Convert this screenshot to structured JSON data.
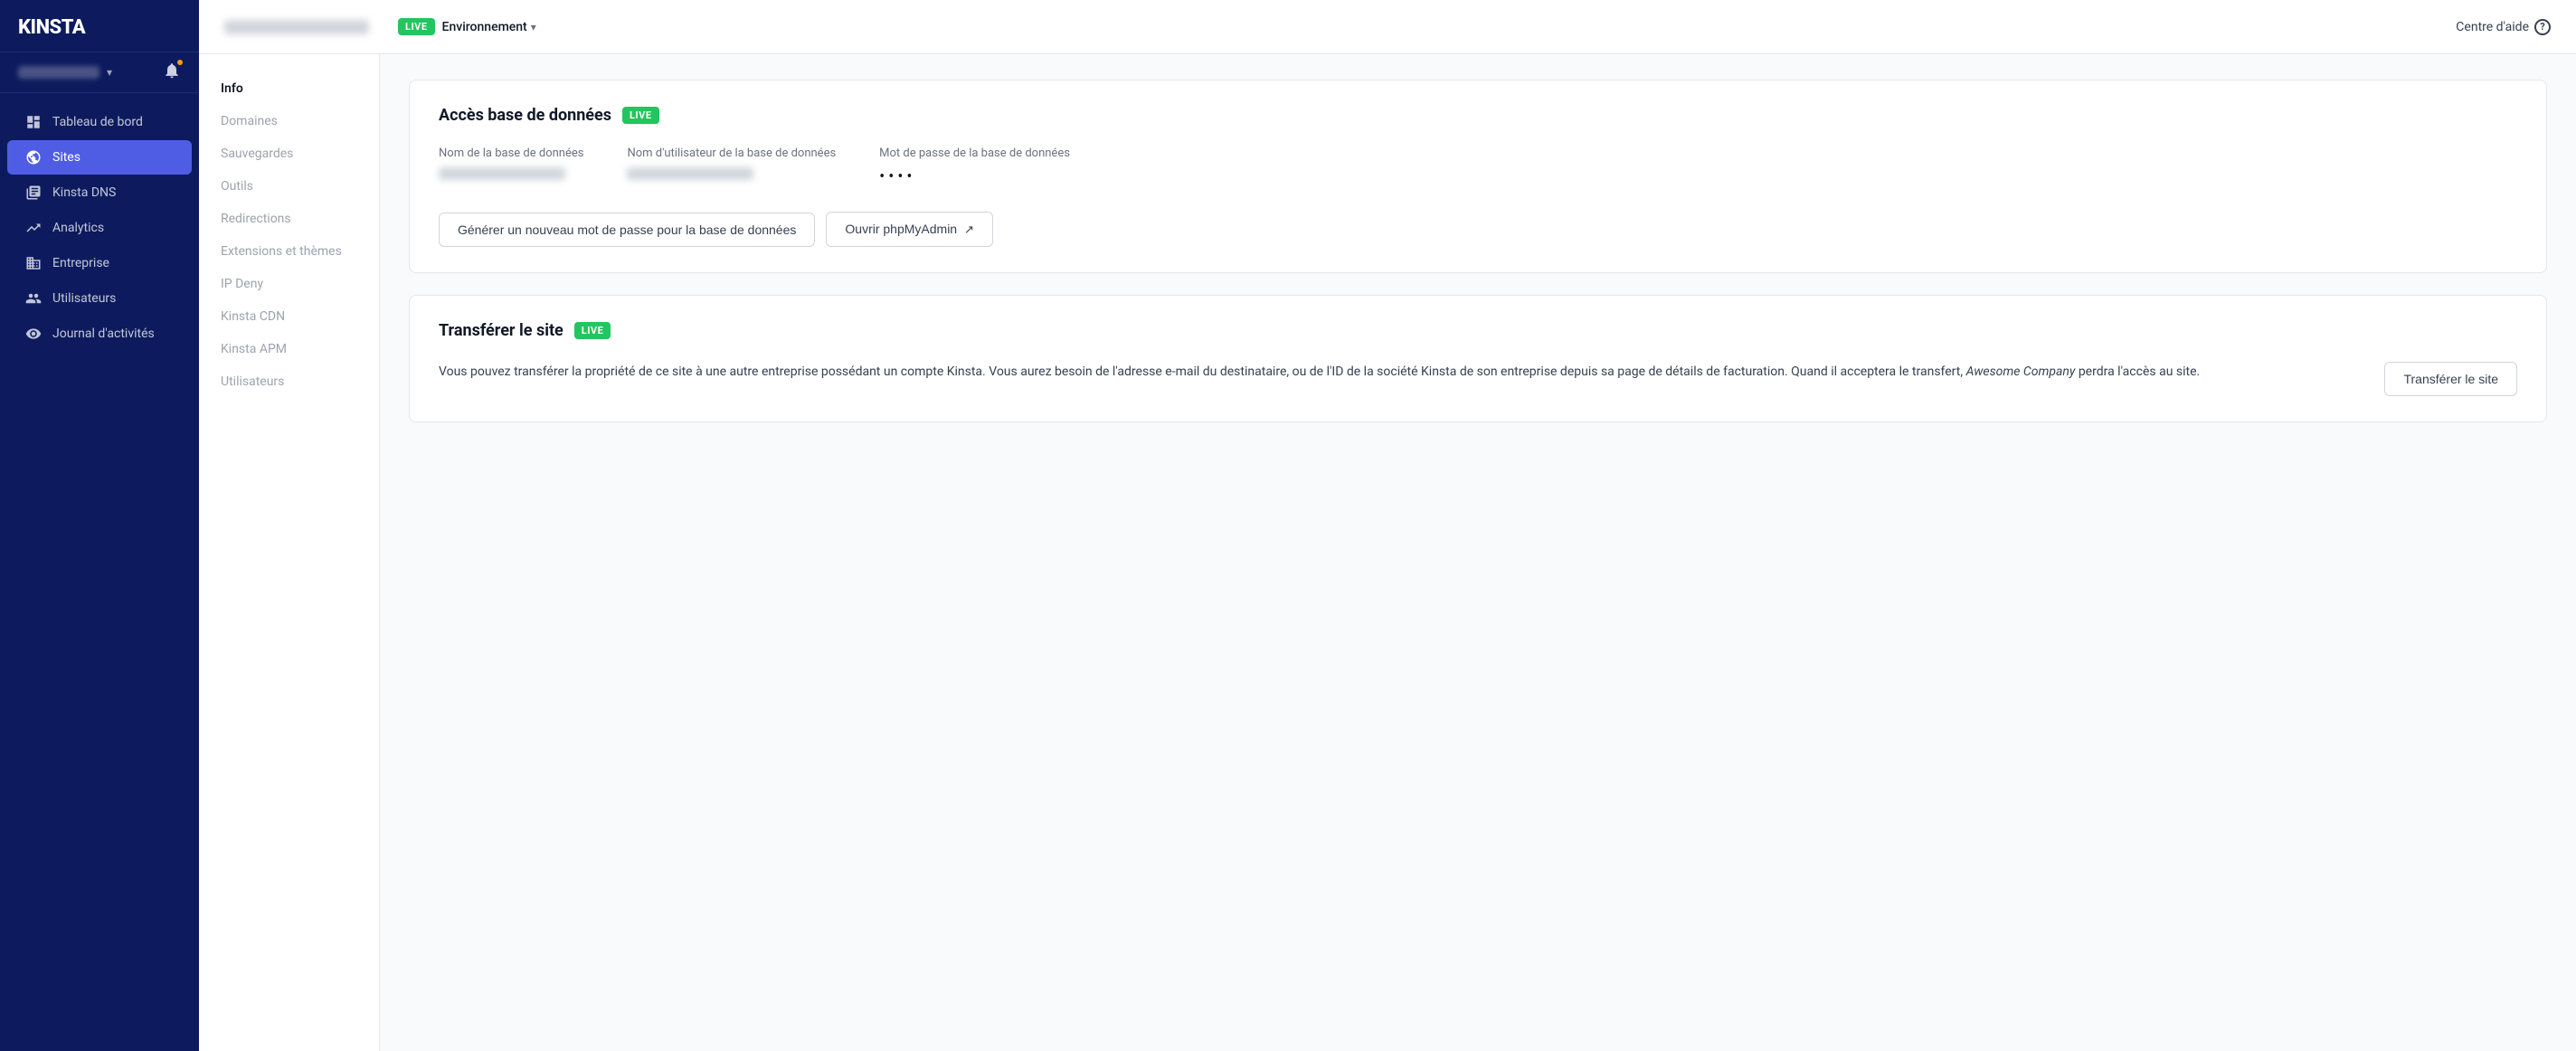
{
  "sidebar": {
    "logo": "KINSTA",
    "account_name_placeholder": "account",
    "nav_items": [
      {
        "id": "tableau-de-bord",
        "label": "Tableau de bord",
        "icon": "home",
        "active": false
      },
      {
        "id": "sites",
        "label": "Sites",
        "icon": "globe",
        "active": true
      },
      {
        "id": "kinsta-dns",
        "label": "Kinsta DNS",
        "icon": "dns",
        "active": false
      },
      {
        "id": "analytics",
        "label": "Analytics",
        "icon": "chart",
        "active": false
      },
      {
        "id": "entreprise",
        "label": "Entreprise",
        "icon": "building",
        "active": false
      },
      {
        "id": "utilisateurs",
        "label": "Utilisateurs",
        "icon": "users",
        "active": false
      },
      {
        "id": "journal",
        "label": "Journal d'activités",
        "icon": "eye",
        "active": false
      }
    ]
  },
  "topbar": {
    "env_label": "Environnement",
    "live_label": "LIVE",
    "help_label": "Centre d'aide"
  },
  "side_menu": {
    "items": [
      {
        "id": "info",
        "label": "Info",
        "active": true,
        "muted": false
      },
      {
        "id": "domaines",
        "label": "Domaines",
        "active": false,
        "muted": true
      },
      {
        "id": "sauvegardes",
        "label": "Sauvegardes",
        "active": false,
        "muted": true
      },
      {
        "id": "outils",
        "label": "Outils",
        "active": false,
        "muted": true
      },
      {
        "id": "redirections",
        "label": "Redirections",
        "active": false,
        "muted": true
      },
      {
        "id": "extensions-themes",
        "label": "Extensions et thèmes",
        "active": false,
        "muted": true
      },
      {
        "id": "ip-deny",
        "label": "IP Deny",
        "active": false,
        "muted": true
      },
      {
        "id": "kinsta-cdn",
        "label": "Kinsta CDN",
        "active": false,
        "muted": true
      },
      {
        "id": "kinsta-apm",
        "label": "Kinsta APM",
        "active": false,
        "muted": true
      },
      {
        "id": "utilisateurs",
        "label": "Utilisateurs",
        "active": false,
        "muted": true
      }
    ]
  },
  "db_section": {
    "title": "Accès base de données",
    "live_badge": "LIVE",
    "field_db_name_label": "Nom de la base de données",
    "field_db_user_label": "Nom d'utilisateur de la base de données",
    "field_db_pass_label": "Mot de passe de la base de données",
    "field_db_pass_value": "••••",
    "btn_generate": "Générer un nouveau mot de passe pour la base de données",
    "btn_phpmyadmin": "Ouvrir phpMyAdmin"
  },
  "transfer_section": {
    "title": "Transférer le site",
    "live_badge": "LIVE",
    "description_1": "Vous pouvez transférer la propriété de ce site à une autre entreprise possédant un compte Kinsta. Vous aurez besoin de l'adresse e-mail du destinataire, ou de l'ID de la société Kinsta de son entreprise depuis sa page de détails de facturation. Quand il acceptera le transfert, ",
    "description_italic": "Awesome Company",
    "description_2": " perdra l'accès au site.",
    "btn_transfer": "Transférer le site"
  }
}
